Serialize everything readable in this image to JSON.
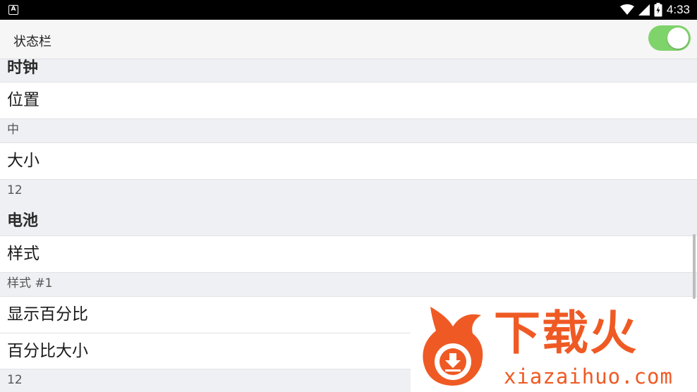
{
  "status_bar": {
    "app_icon": "android-notification-icon",
    "icons": [
      "wifi-icon",
      "signal-icon",
      "battery-icon"
    ],
    "time": "4:33"
  },
  "toolbar": {
    "title": "状态栏",
    "toggle_on": true
  },
  "sections": {
    "clock": {
      "header": "时钟",
      "position_label": "位置",
      "position_value": "中",
      "size_label": "大小",
      "size_value": "12"
    },
    "battery": {
      "header": "电池",
      "style_label": "样式",
      "style_value": "样式 #1",
      "show_percent_label": "显示百分比",
      "percent_size_label": "百分比大小",
      "percent_size_value": "12"
    }
  },
  "watermark": {
    "brand_cn": "下载火",
    "brand_url": "xiazaihuo.com"
  },
  "colors": {
    "toggle_on": "#7fd36b",
    "section_bg": "#eff0f4",
    "watermark": "#ef5a24"
  }
}
